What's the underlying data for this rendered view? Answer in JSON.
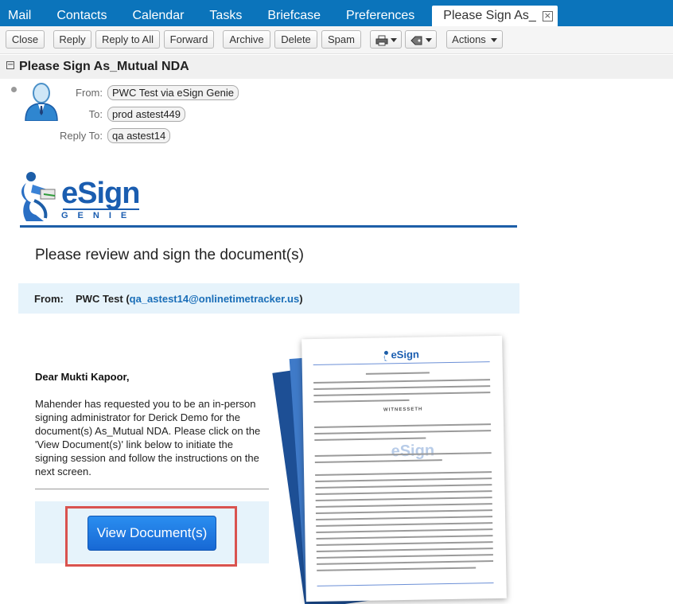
{
  "nav": {
    "tabs": [
      "Mail",
      "Contacts",
      "Calendar",
      "Tasks",
      "Briefcase",
      "Preferences"
    ],
    "active_tab": "Please Sign As_",
    "close_glyph": "×"
  },
  "toolbar": {
    "close": "Close",
    "reply": "Reply",
    "reply_all": "Reply to All",
    "forward": "Forward",
    "archive": "Archive",
    "delete": "Delete",
    "spam": "Spam",
    "actions": "Actions",
    "print_icon": "printer-icon",
    "tag_icon": "tag-icon"
  },
  "subject": "Please Sign As_Mutual NDA",
  "header": {
    "from_label": "From:",
    "from_value": "PWC Test via eSign Genie",
    "to_label": "To:",
    "to_value": "prod astest449",
    "reply_to_label": "Reply To:",
    "reply_to_value": "qa astest14"
  },
  "email": {
    "logo_text": "eSign",
    "logo_sub": "GENIE",
    "heading": "Please review and sign the document(s)",
    "from_label": "From:",
    "from_name": "PWC Test (",
    "from_email": "qa_astest14@onlinetimetracker.us",
    "from_close": ")",
    "greeting": "Dear Mukti Kapoor,",
    "message": "Mahender has requested you to be an in-person signing administrator for Derick Demo for the document(s) As_Mutual NDA. Please click on the 'View Document(s)' link below to initiate the signing session and follow the instructions on the next screen.",
    "button": "View Document(s)",
    "doc_logo": "eSign",
    "doc_watermark": "eSign",
    "doc_title": "WITNESSETH"
  },
  "colors": {
    "nav_bg": "#0b74bb",
    "brand_blue": "#1d5ea8",
    "button_blue": "#1768d4",
    "highlight_red": "#d9534f",
    "panel_bg": "#e6f3fb"
  }
}
